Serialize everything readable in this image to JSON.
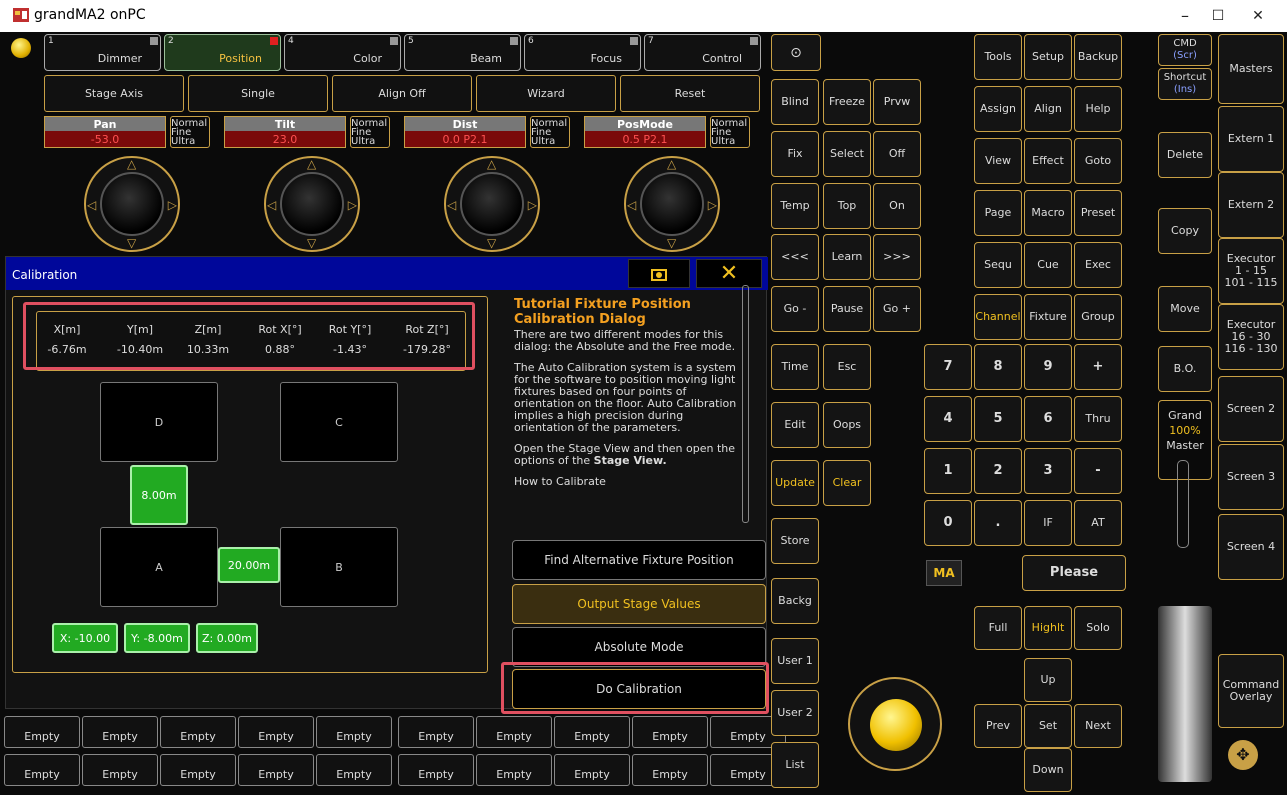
{
  "window": {
    "title": "grandMA2 onPC",
    "min": "–",
    "max": "☐",
    "close": "✕"
  },
  "tabs": [
    {
      "num": "1",
      "label": "Dimmer"
    },
    {
      "num": "2",
      "label": "Position"
    },
    {
      "num": "4",
      "label": "Color"
    },
    {
      "num": "5",
      "label": "Beam"
    },
    {
      "num": "6",
      "label": "Focus"
    },
    {
      "num": "7",
      "label": "Control"
    }
  ],
  "subbar": [
    "Stage Axis",
    "Single",
    "Align Off",
    "Wizard",
    "Reset"
  ],
  "encoders": [
    {
      "name": "Pan",
      "value": "-53.0"
    },
    {
      "name": "Tilt",
      "value": "23.0"
    },
    {
      "name": "Dist",
      "value": "0.0 P2.1"
    },
    {
      "name": "PosMode",
      "value": "0.5 P2.1"
    }
  ],
  "encoder_modes": {
    "normal": "Normal",
    "fine": "Fine",
    "ultra": "Ultra"
  },
  "calibration": {
    "title": "Calibration",
    "headers": [
      "X[m]",
      "Y[m]",
      "Z[m]",
      "Rot X[°]",
      "Rot Y[°]",
      "Rot Z[°]"
    ],
    "values": [
      "-6.76m",
      "-10.40m",
      "10.33m",
      "0.88°",
      "-1.43°",
      "-179.28°"
    ],
    "pads": {
      "d": "D",
      "c": "C",
      "a": "A",
      "b": "B"
    },
    "dist_v": "8.00m",
    "dist_h": "20.00m",
    "x_btn": "X: -10.00",
    "y_btn": "Y: -8.00m",
    "z_btn": "Z: 0.00m",
    "tutorial": {
      "title": "Tutorial  Fixture Position Calibration Dialog",
      "p1": "There are two different modes for this dialog: the Absolute and the Free mode.",
      "p2": "The Auto Calibration system is a system for the software to position moving light fixtures based on four points of orientation on the floor. Auto Calibration implies a high precision during orientation of the parameters.",
      "p3a": "Open the Stage View and then open the options of the ",
      "p3b": "Stage View.",
      "p4": "How to Calibrate"
    },
    "actions": {
      "find": "Find Alternative Fixture Position",
      "output": "Output Stage Values",
      "absolute": "Absolute Mode",
      "do": "Do Calibration"
    }
  },
  "exec_label": "Empty",
  "mid_keys": [
    "Blind",
    "Freeze",
    "Prvw",
    "Fix",
    "Select",
    "Off",
    "Temp",
    "Top",
    "On",
    "<<<",
    "Learn",
    ">>>",
    "Go -",
    "Pause",
    "Go +",
    "Time",
    "Esc",
    "Edit",
    "Oops",
    "Update",
    "Clear",
    "Store",
    "Backg",
    "User 1",
    "User 2",
    "List"
  ],
  "right_keys": [
    "Tools",
    "Setup",
    "Backup",
    "Assign",
    "Align",
    "Help",
    "View",
    "Effect",
    "Goto",
    "Page",
    "Macro",
    "Preset",
    "Sequ",
    "Cue",
    "Exec",
    "Channel",
    "Fixture",
    "Group"
  ],
  "numpad": [
    "7",
    "8",
    "9",
    "+",
    "4",
    "5",
    "6",
    "Thru",
    "1",
    "2",
    "3",
    "-",
    "0",
    ".",
    "IF",
    "AT"
  ],
  "ma_logo": "MA",
  "please": "Please",
  "bottom_keys": [
    "Full",
    "Highlt",
    "Solo",
    "Up",
    "Prev",
    "Set",
    "Next",
    "Down"
  ],
  "side_keys": {
    "cmd": "CMD",
    "scr": "(Scr)",
    "shortcut": "Shortcut",
    "ins": "(Ins)",
    "delete": "Delete",
    "copy": "Copy",
    "move": "Move",
    "bo": "B.O.",
    "grand": "Grand",
    "pct": "100%",
    "master": "Master"
  },
  "far_right": [
    "Masters",
    "Extern 1",
    "Extern 2",
    "Executor\n1 - 15\n101 - 115",
    "Executor\n16 - 30\n116 - 130",
    "Screen 2",
    "Screen 3",
    "Screen 4",
    "Command\nOverlay"
  ]
}
